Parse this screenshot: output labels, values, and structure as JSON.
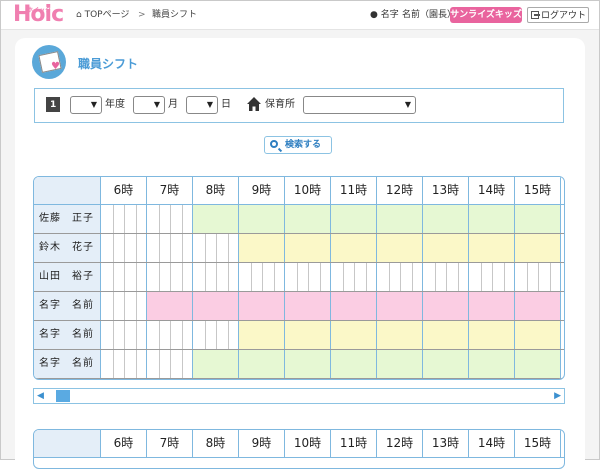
{
  "header": {
    "logo": "Hoic",
    "logo_small": "ホイック",
    "breadcrumb_home": "TOPページ",
    "breadcrumb_sep": ">",
    "breadcrumb_current": "職員シフト",
    "user_label": "名字",
    "user_name": "名前（園長）",
    "nursery_badge": "サンライズキッズ",
    "logout_label": "ログアウト"
  },
  "page": {
    "title": "職員シフト"
  },
  "filter": {
    "year_label": "年度",
    "month_label": "月",
    "day_label": "日",
    "facility_label": "保育所",
    "year_value": "",
    "month_value": "",
    "day_value": "",
    "facility_value": ""
  },
  "search": {
    "label": "検索する"
  },
  "hours": [
    "6時",
    "7時",
    "8時",
    "9時",
    "10時",
    "11時",
    "12時",
    "13時",
    "14時",
    "15時"
  ],
  "staff": [
    {
      "name": "佐藤　正子",
      "color": "#e6f8d3",
      "start": 2,
      "end": 10
    },
    {
      "name": "鈴木　花子",
      "color": "#fbf8c8",
      "start": 3,
      "end": 10
    },
    {
      "name": "山田　裕子",
      "color": "#ffffff",
      "start": 0,
      "end": 0
    },
    {
      "name": "名字　名前",
      "color": "#fbcde3",
      "start": 1,
      "end": 10
    },
    {
      "name": "名字　名前",
      "color": "#fbf8c8",
      "start": 3,
      "end": 10
    },
    {
      "name": "名字　名前",
      "color": "#e6f8d3",
      "start": 2,
      "end": 10
    }
  ],
  "colors": {
    "accent": "#4a9bd6",
    "brand_pink": "#e9649e",
    "grid_border": "#7fb8df"
  },
  "icons": [
    "user-icon",
    "home-icon",
    "calendar-icon",
    "house-icon",
    "search-icon",
    "logout-icon",
    "scroll-left-icon",
    "scroll-right-icon"
  ]
}
